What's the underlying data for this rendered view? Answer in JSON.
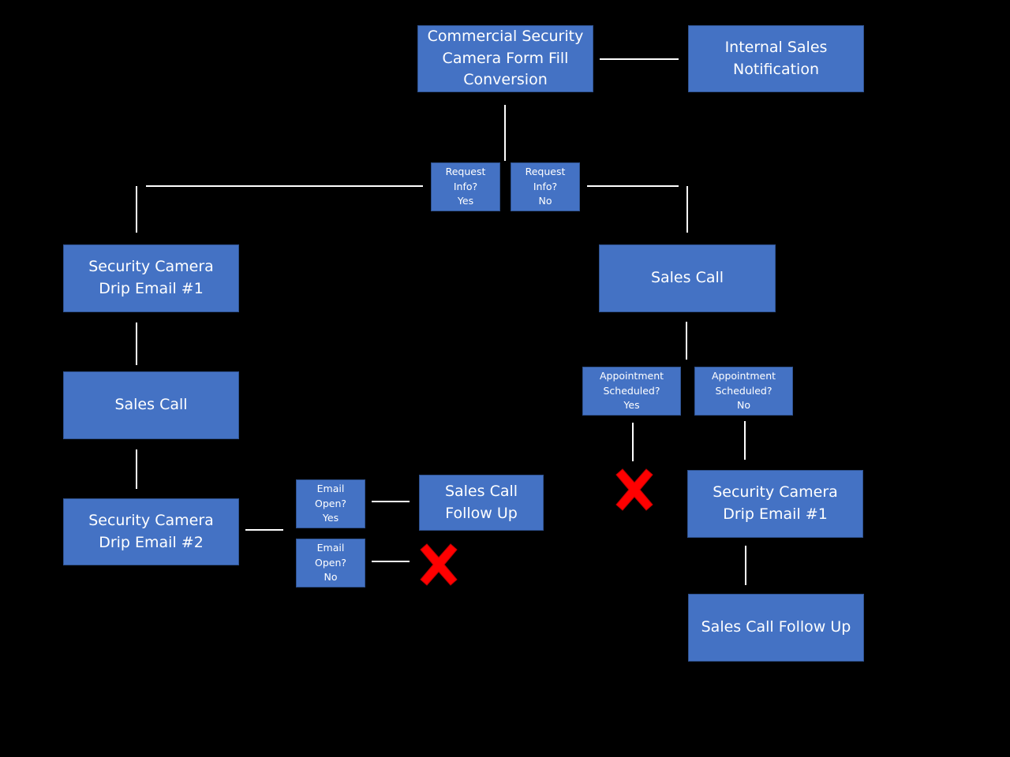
{
  "colors": {
    "box_fill": "#4472C4",
    "box_border": "#2F528F",
    "connector": "#FFFFFF",
    "reject_mark": "#FF0000",
    "background": "#000000"
  },
  "nodes": {
    "form_fill": "Commercial Security\nCamera Form Fill\nConversion",
    "internal_notification": "Internal Sales\nNotification",
    "request_yes": "Request\nInfo?\nYes",
    "request_no": "Request\nInfo?\nNo",
    "left_drip1": "Security Camera\nDrip Email #1",
    "left_sales_call": "Sales Call",
    "left_drip2": "Security Camera\nDrip Email #2",
    "email_open_yes": "Email\nOpen?\nYes",
    "email_open_no": "Email\nOpen?\nNo",
    "mid_follow_up": "Sales Call\nFollow Up",
    "right_sales_call": "Sales Call",
    "appt_yes": "Appointment\nScheduled?\nYes",
    "appt_no": "Appointment\nScheduled?\nNo",
    "right_drip1": "Security Camera\nDrip Email #1",
    "right_follow_up": "Sales Call Follow Up"
  },
  "icons": {
    "end_mark": "red-x-icon"
  }
}
